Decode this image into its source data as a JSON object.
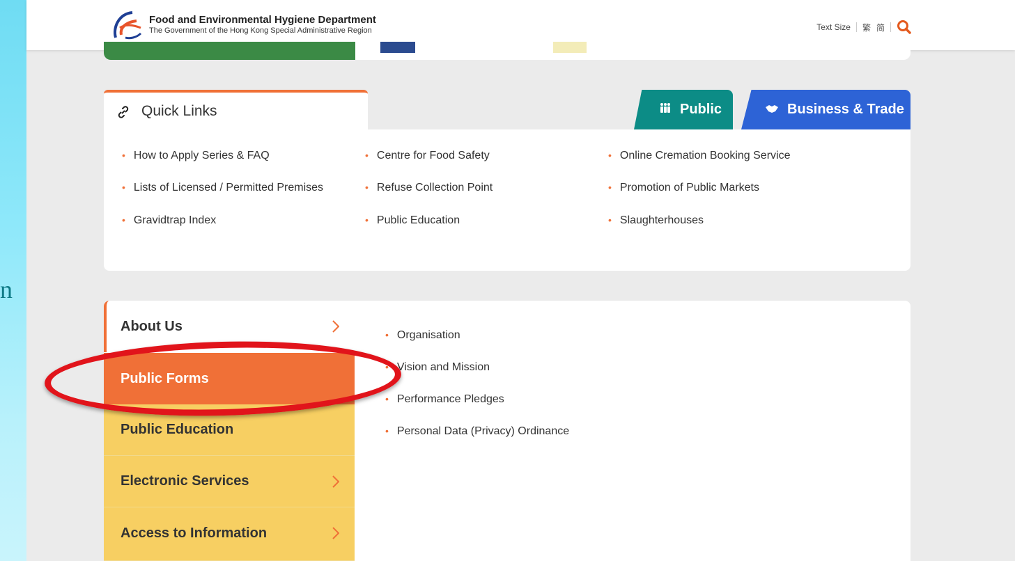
{
  "header": {
    "dept_name": "Food and Environmental Hygiene Department",
    "dept_sub": "The Government of the Hong Kong Special Administrative Region",
    "text_size_label": "Text Size",
    "lang_trad": "繁",
    "lang_simp": "简"
  },
  "side_letter": "n",
  "quick_links": {
    "title": "Quick Links",
    "tabs": [
      {
        "label": "Public"
      },
      {
        "label": "Business & Trade"
      }
    ],
    "items": [
      "How to Apply Series & FAQ",
      "Centre for Food Safety",
      "Online Cremation Booking Service",
      "Lists of Licensed / Permitted Premises",
      "Refuse Collection Point",
      "Promotion of Public Markets",
      "Gravidtrap Index",
      "Public Education",
      "Slaughterhouses"
    ]
  },
  "menu": {
    "items": [
      {
        "label": "About Us"
      },
      {
        "label": "Public Forms"
      },
      {
        "label": "Public Education"
      },
      {
        "label": "Electronic Services"
      },
      {
        "label": "Access to Information"
      }
    ],
    "sub_items": [
      "Organisation",
      "Vision and Mission",
      "Performance Pledges",
      "Personal Data (Privacy) Ordinance"
    ]
  },
  "colors": {
    "accent_orange": "#f07037",
    "public_tab": "#0c8c86",
    "business_tab": "#2d63d6",
    "menu_yellow": "#f7cf62",
    "highlight_red": "#e1141b"
  }
}
